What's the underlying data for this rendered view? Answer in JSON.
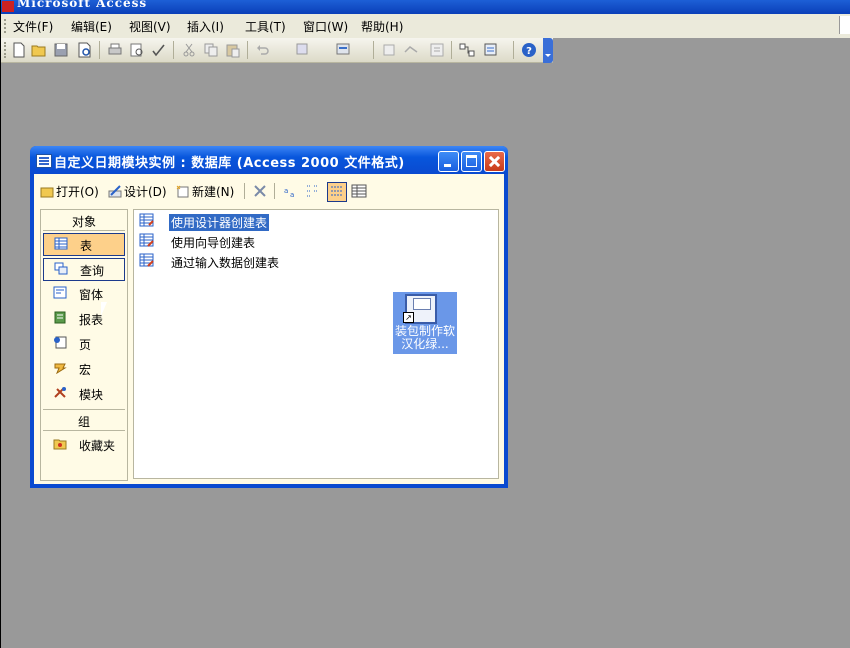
{
  "app": {
    "title": "Microsoft Access"
  },
  "menu": {
    "items": [
      {
        "label": "文件(F)"
      },
      {
        "label": "编辑(E)"
      },
      {
        "label": "视图(V)"
      },
      {
        "label": "插入(I)"
      },
      {
        "label": "工具(T)"
      },
      {
        "label": "窗口(W)"
      },
      {
        "label": "帮助(H)"
      }
    ]
  },
  "toolbar": {
    "icons": [
      "new-icon",
      "open-icon",
      "save-icon",
      "file-search-icon",
      "print-icon",
      "print-preview-icon",
      "spelling-icon",
      "cut-icon",
      "copy-icon",
      "paste-icon",
      "undo-icon",
      "office-links-icon",
      "analyze-icon",
      "properties-icon",
      "relationships-icon",
      "new-object-icon",
      "help-icon"
    ]
  },
  "db_window": {
    "title": "自定义日期模块实例 : 数据库 (Access 2000 文件格式)",
    "toolbar": {
      "open_label": "打开(O)",
      "design_label": "设计(D)",
      "new_label": "新建(N)"
    },
    "objects": {
      "header": "对象",
      "items": [
        {
          "label": "表",
          "icon": "table-icon"
        },
        {
          "label": "查询",
          "icon": "query-icon"
        },
        {
          "label": "窗体",
          "icon": "form-icon"
        },
        {
          "label": "报表",
          "icon": "report-icon"
        },
        {
          "label": "页",
          "icon": "page-icon"
        },
        {
          "label": "宏",
          "icon": "macro-icon"
        },
        {
          "label": "模块",
          "icon": "module-icon"
        }
      ],
      "groups_header": "组",
      "favorites_label": "收藏夹"
    },
    "list": [
      {
        "label": "使用设计器创建表"
      },
      {
        "label": "使用向导创建表"
      },
      {
        "label": "通过输入数据创建表"
      }
    ]
  },
  "desktop_icon": {
    "label_line1": "装包制作软",
    "label_line2": "汉化绿..."
  },
  "colors": {
    "titlebar": "#0a46c8",
    "workspace": "#999999",
    "selection": "#316ac5",
    "object_selected": "#fdd08a"
  }
}
